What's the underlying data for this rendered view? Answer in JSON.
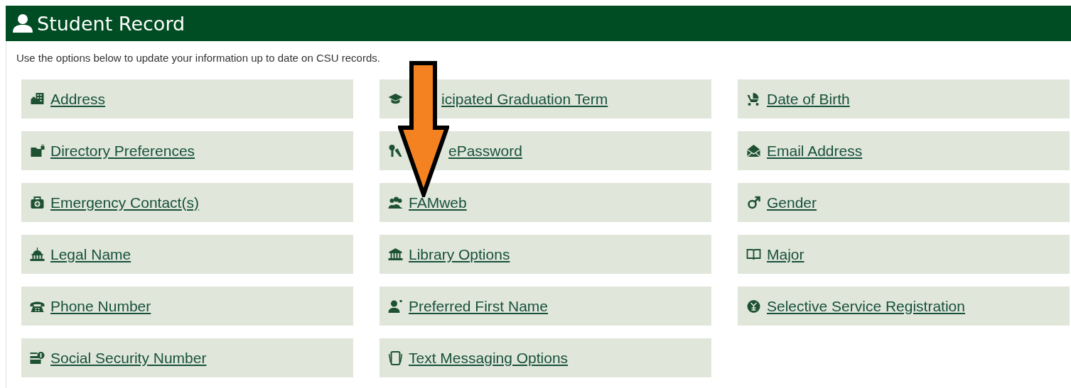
{
  "header": {
    "title": "Student Record"
  },
  "intro": "Use the options below to update your information up to date on CSU records.",
  "options": [
    {
      "label": "Address"
    },
    {
      "label": "icipated Graduation Term"
    },
    {
      "label": "Date of Birth"
    },
    {
      "label": "Directory Preferences"
    },
    {
      "label": "ePassword"
    },
    {
      "label": "Email Address"
    },
    {
      "label": "Emergency Contact(s)"
    },
    {
      "label": "FAMweb"
    },
    {
      "label": "Gender"
    },
    {
      "label": "Legal Name"
    },
    {
      "label": "Library Options"
    },
    {
      "label": "Major"
    },
    {
      "label": "Phone Number"
    },
    {
      "label": "Preferred First Name"
    },
    {
      "label": "Selective Service Registration"
    },
    {
      "label": "Social Security Number"
    },
    {
      "label": "Text Messaging Options"
    }
  ]
}
